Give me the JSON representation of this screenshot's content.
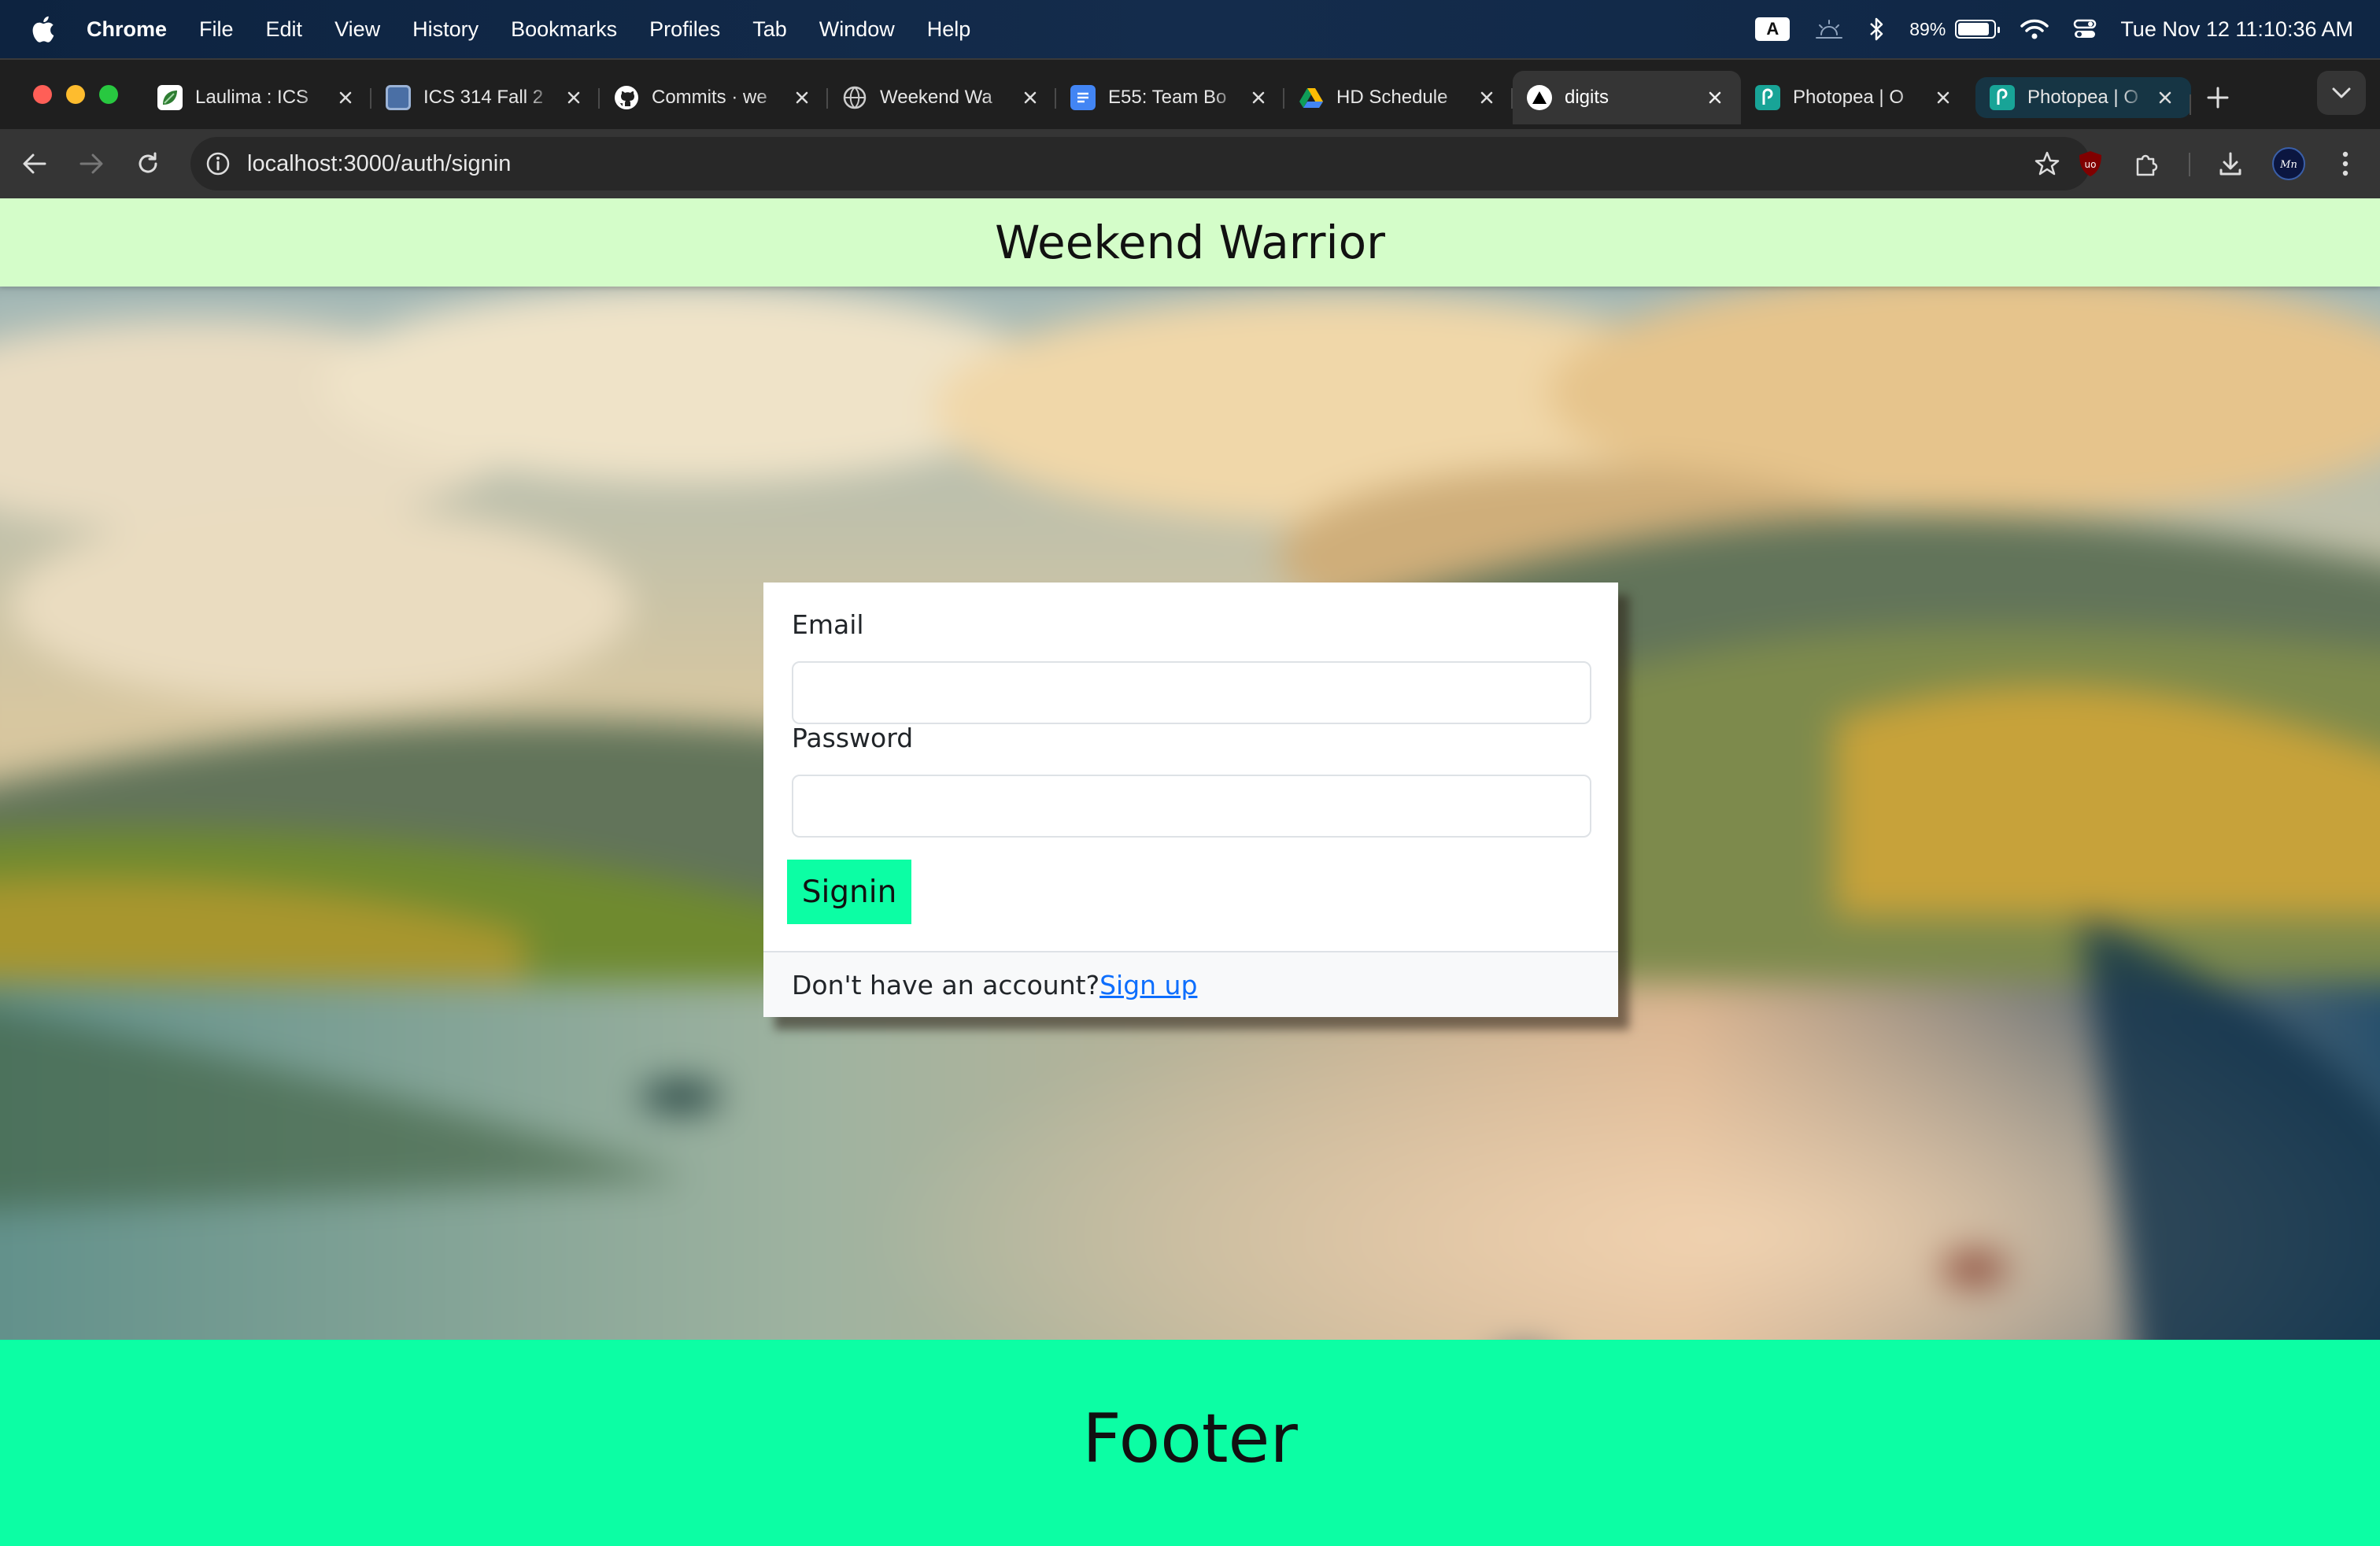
{
  "menubar": {
    "app_name": "Chrome",
    "items": [
      "File",
      "Edit",
      "View",
      "History",
      "Bookmarks",
      "Profiles",
      "Tab",
      "Window",
      "Help"
    ],
    "input_source": "A",
    "battery_percent": "89%",
    "battery_level": 0.89,
    "clock": "Tue Nov 12  11:10:36 AM"
  },
  "tabs": [
    {
      "title": "Laulima : ICS",
      "icon": "laulima-icon",
      "color": "#2e7d32"
    },
    {
      "title": "ICS 314 Fall 2",
      "icon": "ics314-icon",
      "color": "#4a6fa5"
    },
    {
      "title": "Commits · we",
      "icon": "github-icon",
      "color": "#ffffff"
    },
    {
      "title": "Weekend Wa",
      "icon": "globe-icon",
      "color": "#cccccc"
    },
    {
      "title": "E55: Team Bo",
      "icon": "google-docs-icon",
      "color": "#4285f4"
    },
    {
      "title": "HD Schedule",
      "icon": "google-drive-icon",
      "color": "#fbbc04"
    },
    {
      "title": "digits",
      "icon": "vercel-icon",
      "color": "#ffffff",
      "active": true
    },
    {
      "title": "Photopea | O",
      "icon": "photopea-icon",
      "color": "#18a497"
    },
    {
      "title": "Photopea | O",
      "icon": "photopea-icon",
      "color": "#18a497"
    }
  ],
  "toolbar": {
    "url": "localhost:3000/auth/signin"
  },
  "page": {
    "brand": "Weekend Warrior",
    "form": {
      "email_label": "Email",
      "password_label": "Password",
      "submit_label": "Signin",
      "footer_text": "Don't have an account?",
      "signup_link": "Sign up"
    },
    "footer_text": "Footer"
  },
  "colors": {
    "navbar_bg": "#d4fdc9",
    "accent": "#0cfea4",
    "link": "#0d6efd"
  }
}
